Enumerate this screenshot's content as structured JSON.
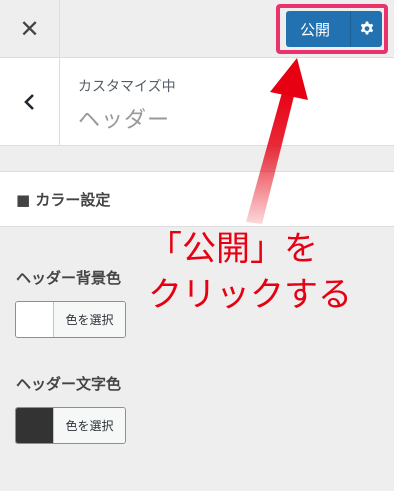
{
  "topbar": {
    "close_glyph": "✕",
    "publish_label": "公開",
    "publish_color": "#2271b1",
    "highlight_color": "#e8336d"
  },
  "section": {
    "breadcrumb": "カスタマイズ中",
    "title": "ヘッダー",
    "back_icon": "chevron-left-icon"
  },
  "panel": {
    "title": "■ カラー設定"
  },
  "controls": [
    {
      "label": "ヘッダー背景色",
      "button": "色を選択",
      "swatch": "#ffffff"
    },
    {
      "label": "ヘッダー文字色",
      "button": "色を選択",
      "swatch": "#333333"
    }
  ],
  "annotation": {
    "line1": "「公開」を",
    "line2": "クリックする",
    "color": "#e60012"
  }
}
